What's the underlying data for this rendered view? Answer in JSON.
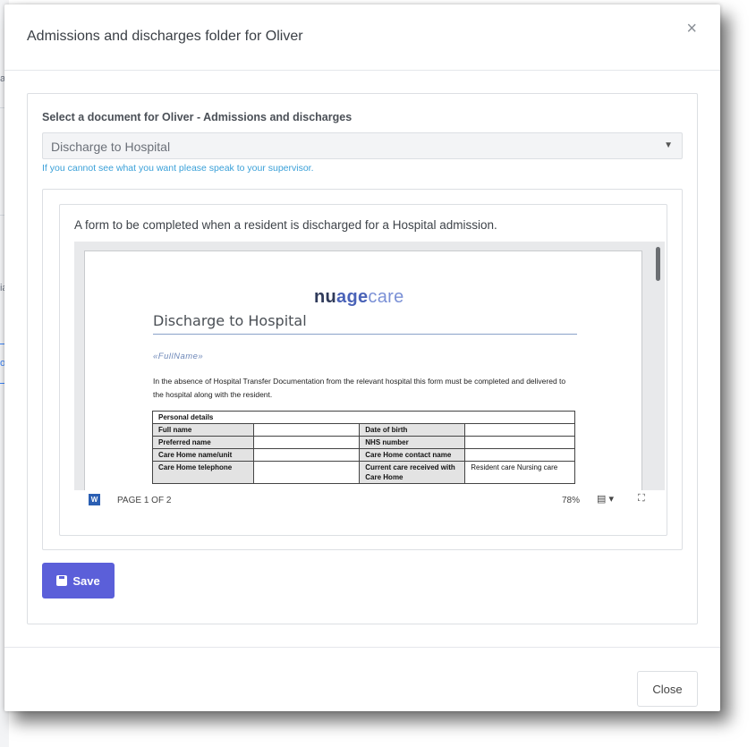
{
  "modal": {
    "title": "Admissions and discharges folder for Oliver",
    "close_icon": "×"
  },
  "background": {
    "fragment_a": "a",
    "fragment_b": "ia",
    "fragment_c": "o"
  },
  "form": {
    "select_label": "Select a document for Oliver - Admissions and discharges",
    "select_value": "Discharge to Hospital",
    "help_text": "If you cannot see what you want please speak to your supervisor."
  },
  "document": {
    "description": "A form to be completed when a resident is discharged for a Hospital admission.",
    "preview": {
      "logo": {
        "part1": "nu",
        "part2": "age",
        "part3": "care"
      },
      "title": "Discharge to Hospital",
      "merge_field": "«FullName»",
      "paragraph": "In the absence of Hospital Transfer Documentation from the relevant hospital this form must be completed and delivered to the hospital along with the resident.",
      "table": {
        "header": "Personal details",
        "rows": [
          [
            "Full name",
            "",
            "Date of birth",
            ""
          ],
          [
            "Preferred name",
            "",
            "NHS number",
            ""
          ],
          [
            "Care Home name/unit",
            "",
            "Care Home contact name",
            ""
          ],
          [
            "Care Home telephone",
            "",
            "Current care received with Care Home",
            "Resident care Nursing care"
          ]
        ]
      }
    },
    "toolbar": {
      "word_icon": "W",
      "page_count": "PAGE 1 OF 2",
      "zoom": "78%",
      "view_icon": "▤ ▾",
      "fit_icon": "⛶"
    }
  },
  "actions": {
    "save_label": "Save",
    "close_label": "Close"
  },
  "colors": {
    "primary": "#5b5fd9",
    "help_text": "#3aa0d8"
  }
}
